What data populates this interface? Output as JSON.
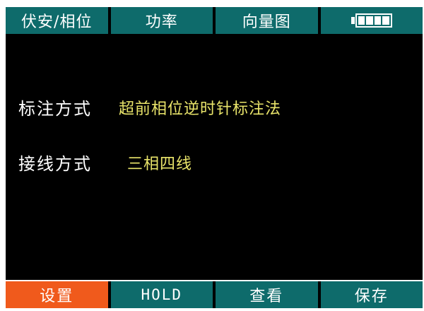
{
  "tabs": [
    {
      "label": "伏安/相位"
    },
    {
      "label": "功率"
    },
    {
      "label": "向量图"
    }
  ],
  "battery": {
    "icon": "battery-icon",
    "level": 0.8
  },
  "settings": {
    "annotation_mode": {
      "label": "标注方式",
      "value": "超前相位逆时针标注法"
    },
    "wiring_mode": {
      "label": "接线方式",
      "value": "三相四线"
    }
  },
  "buttons": [
    {
      "label": "设置",
      "active": true
    },
    {
      "label": "HOLD"
    },
    {
      "label": "查看"
    },
    {
      "label": "保存"
    }
  ],
  "colors": {
    "bar": "#0e6b6b",
    "active": "#f05a1c",
    "value_text": "#e9e46a",
    "background": "#000000"
  }
}
